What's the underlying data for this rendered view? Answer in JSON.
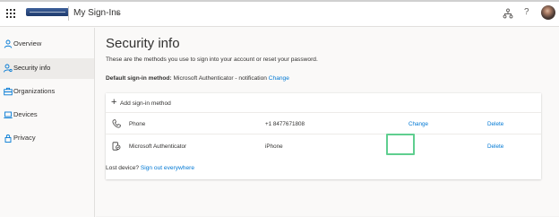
{
  "header": {
    "app_title": "My Sign-Ins",
    "icons": [
      "waffle-icon",
      "company-logo",
      "org-icon",
      "help-icon",
      "avatar"
    ],
    "help_glyph": "?"
  },
  "sidebar": {
    "items": [
      {
        "label": "Overview",
        "icon": "person-icon",
        "active": false
      },
      {
        "label": "Security info",
        "icon": "security-info-icon",
        "active": true
      },
      {
        "label": "Organizations",
        "icon": "briefcase-icon",
        "active": false
      },
      {
        "label": "Devices",
        "icon": "laptop-icon",
        "active": false
      },
      {
        "label": "Privacy",
        "icon": "lock-icon",
        "active": false
      }
    ]
  },
  "main": {
    "title": "Security info",
    "description": "These are the methods you use to sign into your account or reset your password.",
    "default_label": "Default sign-in method:",
    "default_value": "Microsoft Authenticator - notification",
    "default_change": "Change",
    "add_method": "Add sign-in method",
    "methods": [
      {
        "name": "Phone",
        "detail": "+1 8477671808",
        "change": "Change",
        "delete": "Delete",
        "icon": "phone-icon"
      },
      {
        "name": "Microsoft Authenticator",
        "detail": "iPhone",
        "change": "",
        "delete": "Delete",
        "icon": "authenticator-icon"
      }
    ],
    "lost_device_text": "Lost device?",
    "sign_out_everywhere": "Sign out everywhere"
  },
  "colors": {
    "accent": "#0078d4",
    "highlight": "#5fce8f",
    "active_nav": "#edebe9"
  }
}
